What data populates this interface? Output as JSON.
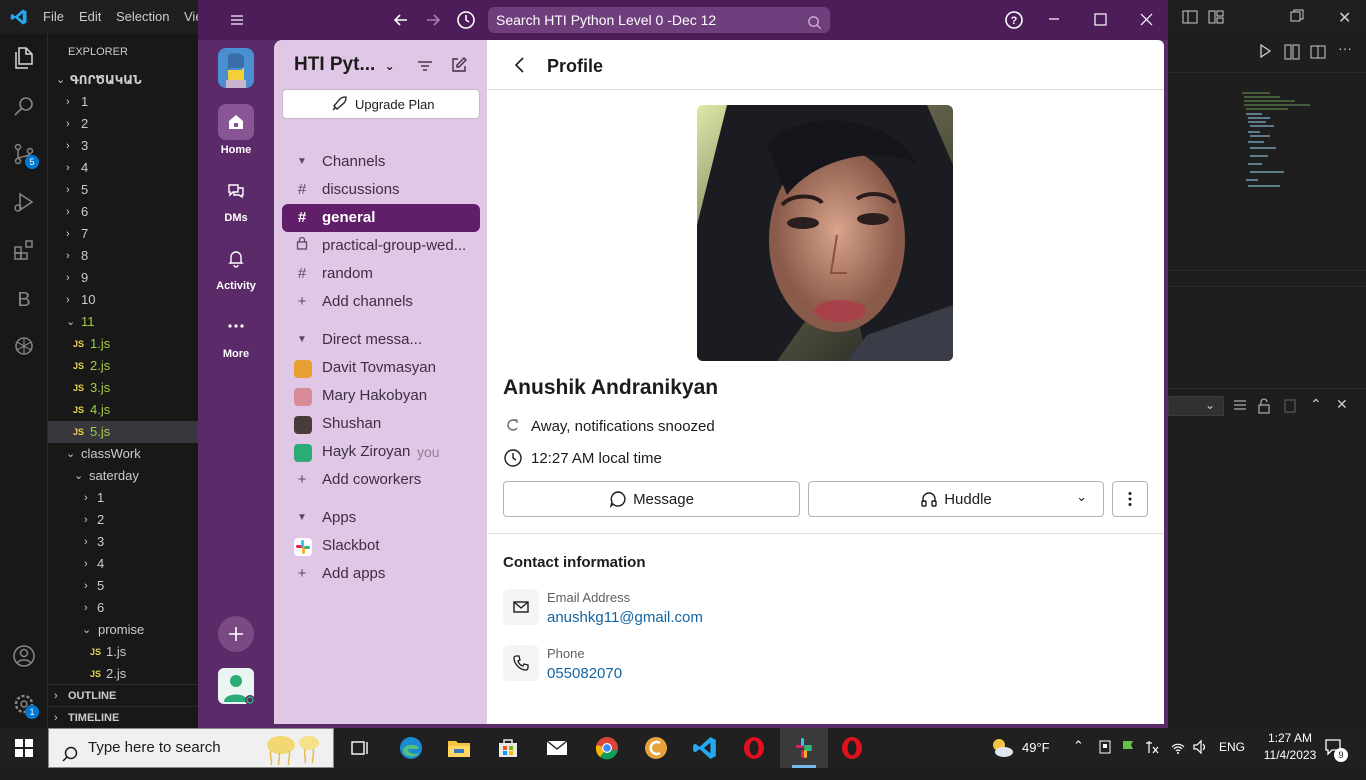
{
  "vscode": {
    "menus": [
      "File",
      "Edit",
      "Selection",
      "Vie"
    ],
    "explorer_title": "EXPLORER",
    "root_folder": "ԳՈՐԾԱԿԱՆ",
    "folders": [
      "1",
      "2",
      "3",
      "4",
      "5",
      "6",
      "7",
      "8",
      "9",
      "10",
      "11"
    ],
    "folder11_files": [
      "1.js",
      "2.js",
      "3.js",
      "4.js",
      "5.js"
    ],
    "classwork": "classWork",
    "saterday": "saterday",
    "saterday_folders": [
      "1",
      "2",
      "3",
      "4",
      "5",
      "6"
    ],
    "promise": "promise",
    "promise_files": [
      "1.js",
      "2.js"
    ],
    "js_label": "JS",
    "outline": "OUTLINE",
    "timeline": "TIMELINE",
    "source_control_badge": "5",
    "account_badge": "1"
  },
  "slack": {
    "search_placeholder": "Search HTI Python Level 0 -Dec 12",
    "workspace_name": "HTI Pyt...",
    "upgrade_label": "Upgrade Plan",
    "rail": {
      "home": "Home",
      "dms": "DMs",
      "activity": "Activity",
      "more": "More"
    },
    "channels_header": "Channels",
    "channels": [
      {
        "name": "discussions",
        "icon": "#"
      },
      {
        "name": "general",
        "icon": "#"
      },
      {
        "name": "practical-group-wed...",
        "icon": "lock"
      },
      {
        "name": "random",
        "icon": "#"
      }
    ],
    "add_channels": "Add channels",
    "dm_header": "Direct messa...",
    "dms": [
      {
        "name": "Davit Tovmasyan",
        "suffix": ""
      },
      {
        "name": "Mary Hakobyan",
        "suffix": ""
      },
      {
        "name": "Shushan",
        "suffix": ""
      },
      {
        "name": "Hayk Ziroyan",
        "suffix": "you"
      }
    ],
    "add_coworkers": "Add coworkers",
    "apps_header": "Apps",
    "apps": [
      "Slackbot"
    ],
    "add_apps": "Add apps",
    "profile": {
      "header": "Profile",
      "name": "Anushik Andranikyan",
      "status": "Away, notifications snoozed",
      "local_time": "12:27 AM local time",
      "message_btn": "Message",
      "huddle_btn": "Huddle",
      "contact_title": "Contact information",
      "email_label": "Email Address",
      "email": "anushkg11@gmail.com",
      "phone_label": "Phone",
      "phone": "055082070"
    },
    "colors": {
      "aubergine": "#4d1d5a",
      "sidebar": "#e0c7e6",
      "active": "#611f69",
      "link": "#1264a3"
    }
  },
  "taskbar": {
    "search_placeholder": "Type here to search",
    "weather": "49°F",
    "lang": "ENG",
    "time": "1:27 AM",
    "date": "11/4/2023",
    "notif_count": "9"
  }
}
